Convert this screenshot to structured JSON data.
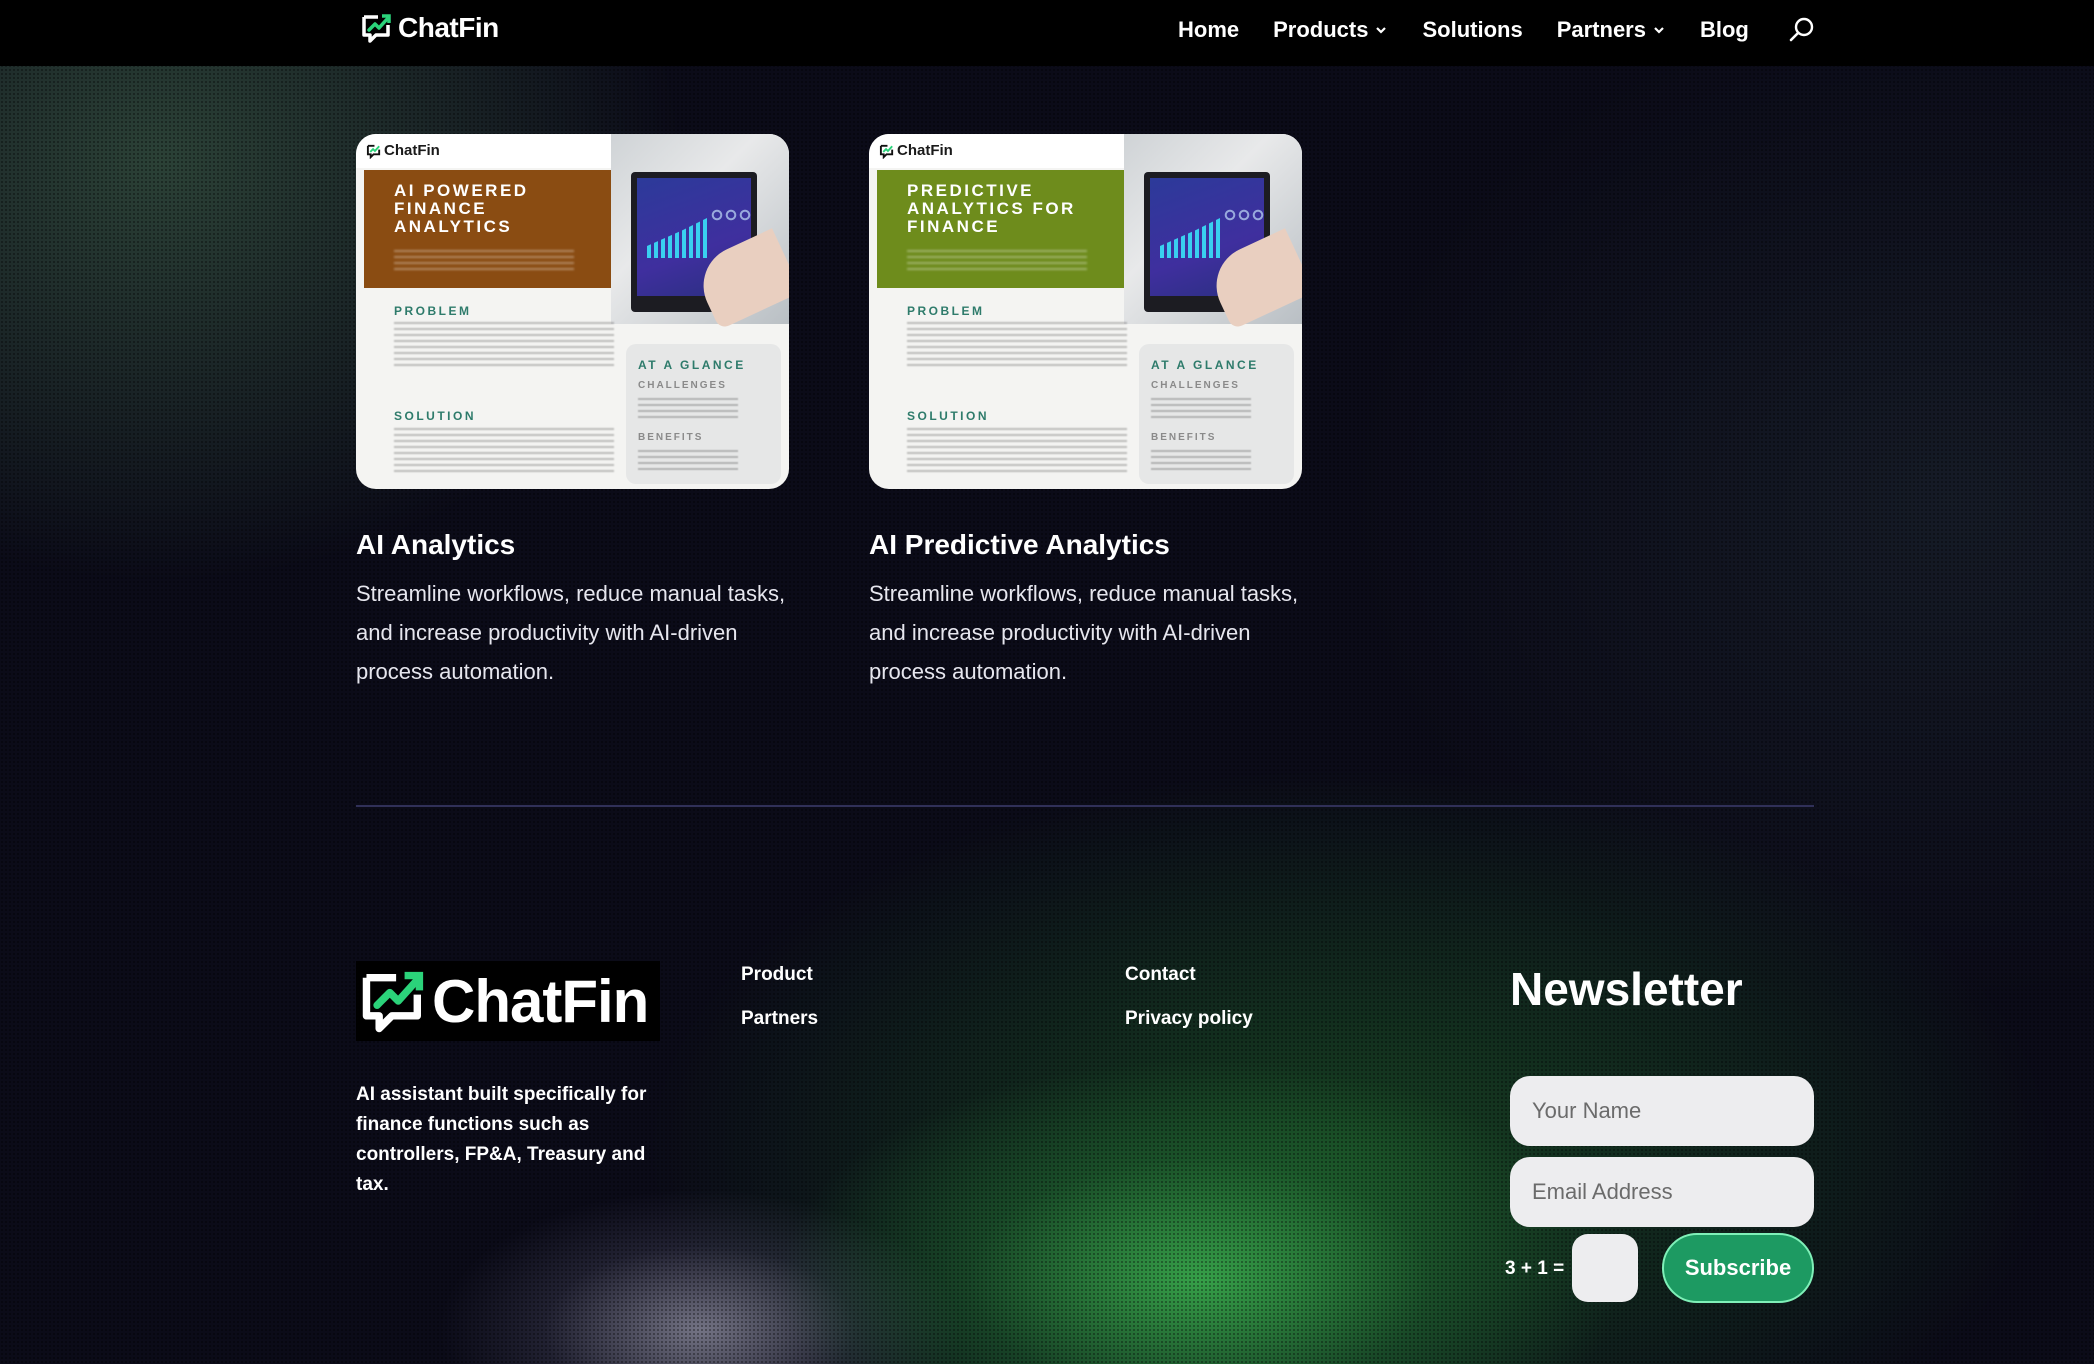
{
  "header": {
    "brand": "ChatFin",
    "nav": [
      {
        "label": "Home"
      },
      {
        "label": "Products"
      },
      {
        "label": "Solutions"
      },
      {
        "label": "Partners"
      },
      {
        "label": "Blog"
      }
    ],
    "search_icon": "search-icon"
  },
  "cards": [
    {
      "image": {
        "brand": "ChatFin",
        "title": "AI POWERED FINANCE ANALYTICS",
        "band_color": "#8a4c12",
        "problem_label": "PROBLEM",
        "solution_label": "SOLUTION",
        "glance_label": "AT A GLANCE",
        "challenges_label": "CHALLENGES",
        "benefits_label": "BENEFITS"
      },
      "title": "AI Analytics",
      "description": "Streamline workflows, reduce manual tasks, and increase productivity with AI-driven process automation."
    },
    {
      "image": {
        "brand": "ChatFin",
        "title": "PREDICTIVE ANALYTICS FOR FINANCE",
        "band_color": "#6e8c1c",
        "problem_label": "PROBLEM",
        "solution_label": "SOLUTION",
        "glance_label": "AT A GLANCE",
        "challenges_label": "CHALLENGES",
        "benefits_label": "BENEFITS"
      },
      "title": "AI Predictive Analytics",
      "description": "Streamline workflows, reduce manual tasks, and increase productivity with AI-driven process automation."
    }
  ],
  "footer": {
    "brand": "ChatFin",
    "about": "AI assistant built specifically for finance functions such as controllers, FP&A, Treasury and tax.",
    "links_col1": [
      "Product",
      "Partners"
    ],
    "links_col2": [
      "Contact",
      "Privacy policy"
    ],
    "newsletter": {
      "title": "Newsletter",
      "name_placeholder": "Your Name",
      "email_placeholder": "Email Address",
      "captcha_label": "3 + 1 =",
      "subscribe_label": "Subscribe"
    }
  },
  "colors": {
    "accent": "#1d9a62",
    "brand_green": "#2bd37a",
    "background": "#0b0b18"
  }
}
